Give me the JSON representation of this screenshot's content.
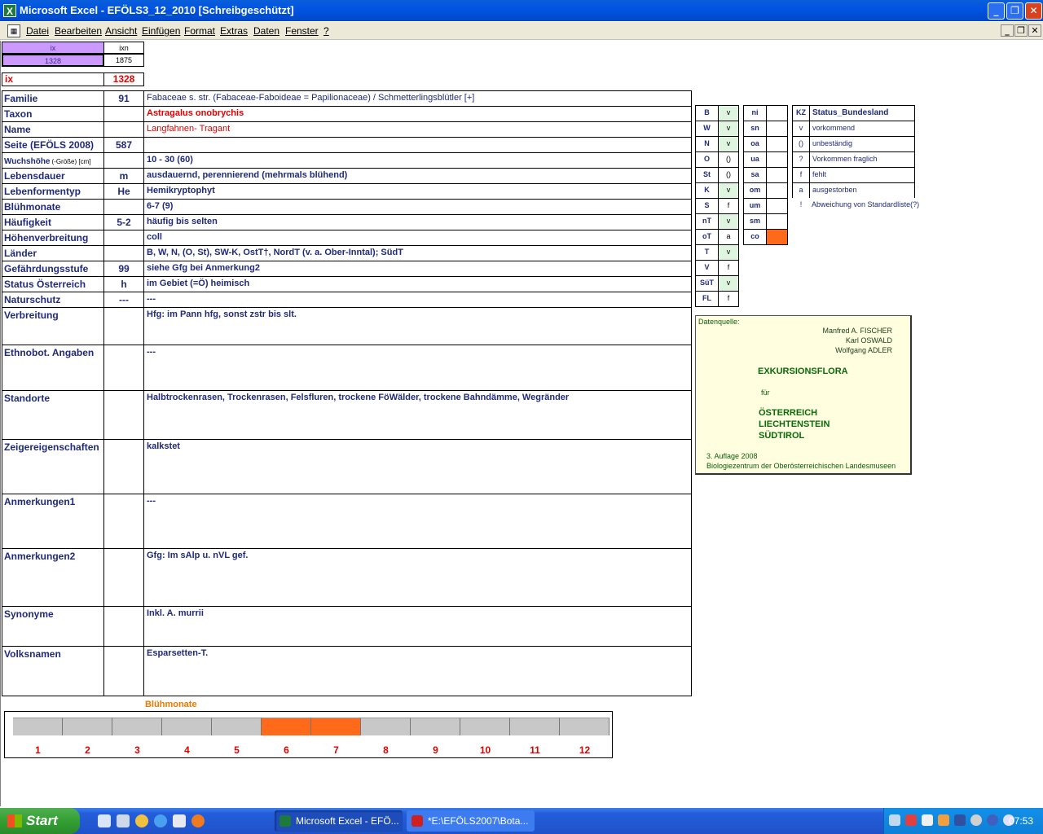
{
  "window": {
    "title": "Microsoft Excel - EFÖLS3_12_2010  [Schreibgeschützt]"
  },
  "menu": [
    "Datei",
    "Bearbeiten",
    "Ansicht",
    "Einfügen",
    "Format",
    "Extras",
    "Daten",
    "Fenster",
    "?"
  ],
  "top": {
    "ix_label": "ix",
    "ixn_label": "ixn",
    "ix_val": "1328",
    "ixn_val": "1875",
    "ix2_label": "ix",
    "ix2_val": "1328"
  },
  "rows": [
    {
      "label": "Familie",
      "code": "91",
      "value": "Fabaceae s. str. (Fabaceae-Faboideae = Papilionaceae)  /  Schmetterlingsblütler [+]"
    },
    {
      "label": "Taxon",
      "code": "",
      "value": "Astragalus onobrychis"
    },
    {
      "label": "Name",
      "code": "",
      "value": "Langfahnen- Tragant"
    },
    {
      "label": "Seite (EFÖLS 2008)",
      "code": "587",
      "value": ""
    },
    {
      "label": "Wuchshöhe",
      "label_small": "(-Größe) [cm]",
      "code": "",
      "value": " 10 - 30 (60)"
    },
    {
      "label": "Lebensdauer",
      "code": "m",
      "value": "ausdauernd, perennierend (mehrmals blühend)"
    },
    {
      "label": "Lebenformentyp",
      "code": "He",
      "value": "Hemikryptophyt"
    },
    {
      "label": "Blühmonate",
      "code": "",
      "value": " 6-7 (9)"
    },
    {
      "label": "Häufigkeit",
      "code": "5-2",
      "value": "häufig bis selten"
    },
    {
      "label": "Höhenverbreitung",
      "code": "",
      "value": "coll"
    },
    {
      "label": "Länder",
      "code": "",
      "value": "B, W, N, (O, St), SW-K, OstT†, NordT (v. a. Ober-Inntal); SüdT"
    },
    {
      "label": "Gefährdungsstufe",
      "code": "99",
      "value": "siehe Gfg bei Anmerkung2"
    },
    {
      "label": "Status Österreich",
      "code": "h",
      "value": "im Gebiet (=Ö) heimisch"
    },
    {
      "label": "Naturschutz",
      "code": "---",
      "value": "---"
    },
    {
      "label": "Verbreitung",
      "code": "",
      "value": "Hfg:  im Pann hfg, sonst zstr bis slt."
    },
    {
      "label": "Ethnobot. Angaben",
      "code": "",
      "value": "---"
    },
    {
      "label": "Standorte",
      "code": "",
      "value": "Halbtrockenrasen, Trockenrasen, Felsfluren, trockene FöWälder, trockene Bahndämme, Wegränder"
    },
    {
      "label": "Zeigereigenschaften",
      "code": "",
      "value": "kalkstet"
    },
    {
      "label": "Anmerkungen1",
      "code": "",
      "value": "---"
    },
    {
      "label": "Anmerkungen2",
      "code": "",
      "value": "Gfg:  Im sAlp u. nVL gef."
    },
    {
      "label": "Synonyme",
      "code": "",
      "value": "Inkl. A. murrii"
    },
    {
      "label": "Volksnamen",
      "code": "",
      "value": "Esparsetten-T."
    }
  ],
  "states": [
    {
      "code": "B",
      "val": "v"
    },
    {
      "code": "W",
      "val": "v"
    },
    {
      "code": "N",
      "val": "v"
    },
    {
      "code": "O",
      "val": "()"
    },
    {
      "code": "St",
      "val": "()"
    },
    {
      "code": "K",
      "val": "v"
    },
    {
      "code": "S",
      "val": "f"
    },
    {
      "code": "nT",
      "val": "v"
    },
    {
      "code": "oT",
      "val": "a"
    },
    {
      "code": "T",
      "val": "v"
    },
    {
      "code": "V",
      "val": "f"
    },
    {
      "code": "SüT",
      "val": "v"
    },
    {
      "code": "FL",
      "val": "f"
    }
  ],
  "zones": [
    {
      "code": "ni",
      "val": ""
    },
    {
      "code": "sn",
      "val": ""
    },
    {
      "code": "oa",
      "val": ""
    },
    {
      "code": "ua",
      "val": ""
    },
    {
      "code": "sa",
      "val": ""
    },
    {
      "code": "om",
      "val": ""
    },
    {
      "code": "um",
      "val": ""
    },
    {
      "code": "sm",
      "val": ""
    },
    {
      "code": "co",
      "val": ""
    }
  ],
  "legend": {
    "header_code": "KZ",
    "header_label": "Status_Bundesland",
    "items": [
      {
        "code": "v",
        "label": "vorkommend"
      },
      {
        "code": "()",
        "label": "unbeständig"
      },
      {
        "code": "?",
        "label": "Vorkommen fraglich"
      },
      {
        "code": "f",
        "label": "fehlt"
      },
      {
        "code": "a",
        "label": "ausgestorben"
      },
      {
        "code": "!",
        "label": "Abweichung von Standardliste(?)"
      }
    ]
  },
  "source": {
    "heading": "Datenquelle:",
    "authors": [
      "Manfred A. FISCHER",
      "Karl OSWALD",
      "Wolfgang ADLER"
    ],
    "title": "EXKURSIONSFLORA",
    "fuer": "für",
    "countries": [
      "ÖSTERREICH",
      "LIECHTENSTEIN",
      "SÜDTIROL"
    ],
    "edition": "3. Auflage 2008",
    "publisher": "Biologiezentrum der Oberösterreichischen Landesmuseen"
  },
  "bloom": {
    "title": "Blühmonate",
    "months": [
      "1",
      "2",
      "3",
      "4",
      "5",
      "6",
      "7",
      "8",
      "9",
      "10",
      "11",
      "12"
    ],
    "active": [
      6,
      7
    ],
    "colors": {
      "active": "#ff6a1a",
      "inactive": "#c8c8c8"
    }
  },
  "taskbar": {
    "start": "Start",
    "tasks": [
      "Microsoft Excel - EFÖ...",
      "*E:\\EFÖLS2007\\Bota..."
    ],
    "clock": "07:53"
  }
}
